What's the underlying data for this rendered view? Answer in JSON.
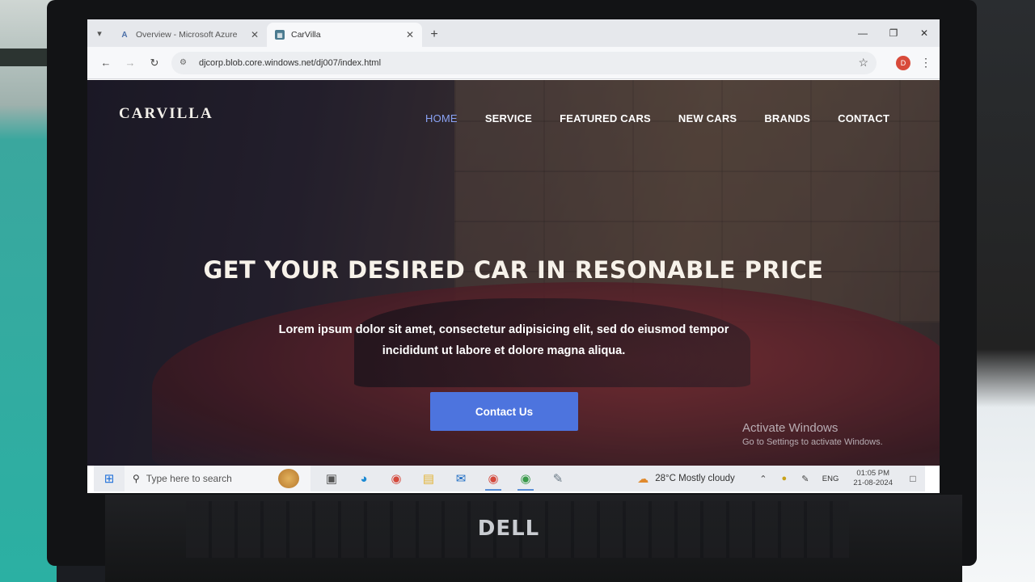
{
  "browser": {
    "tabs": [
      {
        "title": "Overview - Microsoft Azure",
        "icon": "azure-icon",
        "active": false
      },
      {
        "title": "CarVilla",
        "icon": "carvilla-favicon",
        "active": true
      }
    ],
    "new_tab": "+",
    "url": "djcorp.blob.core.windows.net/dj007/index.html",
    "profile_initial": "D"
  },
  "site": {
    "brand": "CARVILLA",
    "nav": [
      {
        "label": "HOME",
        "active": true
      },
      {
        "label": "SERVICE",
        "active": false
      },
      {
        "label": "FEATURED CARS",
        "active": false
      },
      {
        "label": "NEW CARS",
        "active": false
      },
      {
        "label": "BRANDS",
        "active": false
      },
      {
        "label": "CONTACT",
        "active": false
      }
    ],
    "hero_title": "GET YOUR DESIRED CAR IN RESONABLE PRICE",
    "hero_description": "Lorem ipsum dolor sit amet, consectetur adipisicing elit, sed do eiusmod tempor incididunt ut labore et dolore magna aliqua.",
    "cta_label": "Contact Us",
    "accent_color": "#4d74de",
    "active_nav_color": "#8aa3f5"
  },
  "watermark": {
    "title": "Activate Windows",
    "subtitle": "Go to Settings to activate Windows."
  },
  "taskbar": {
    "search_placeholder": "Type here to search",
    "weather": "28°C  Mostly cloudy",
    "language": "ENG",
    "time": "01:05 PM",
    "date": "21-08-2024"
  },
  "hardware": {
    "brand": "DELL"
  }
}
